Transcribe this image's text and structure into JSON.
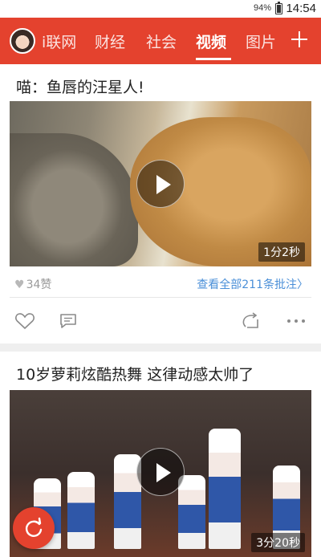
{
  "status_bar": {
    "battery": "94%",
    "time": "14:54"
  },
  "nav": {
    "tabs": [
      {
        "label": "i联网"
      },
      {
        "label": "财经"
      },
      {
        "label": "社会"
      },
      {
        "label": "视频"
      },
      {
        "label": "图片"
      }
    ],
    "active_tab": "视频",
    "accent_color": "#e4422e"
  },
  "feed": [
    {
      "title": "喵：鱼唇的汪星人!",
      "duration": "1分2秒",
      "likes": "34赞",
      "comments_link": "查看全部211条批注"
    },
    {
      "title": "10岁萝莉炫酷热舞 这律动感太帅了",
      "duration": "3分20秒"
    }
  ],
  "icons": [
    "avatar",
    "plus-icon",
    "play-icon",
    "heart-icon",
    "comment-icon",
    "share-icon",
    "more-icon",
    "refresh-icon"
  ]
}
